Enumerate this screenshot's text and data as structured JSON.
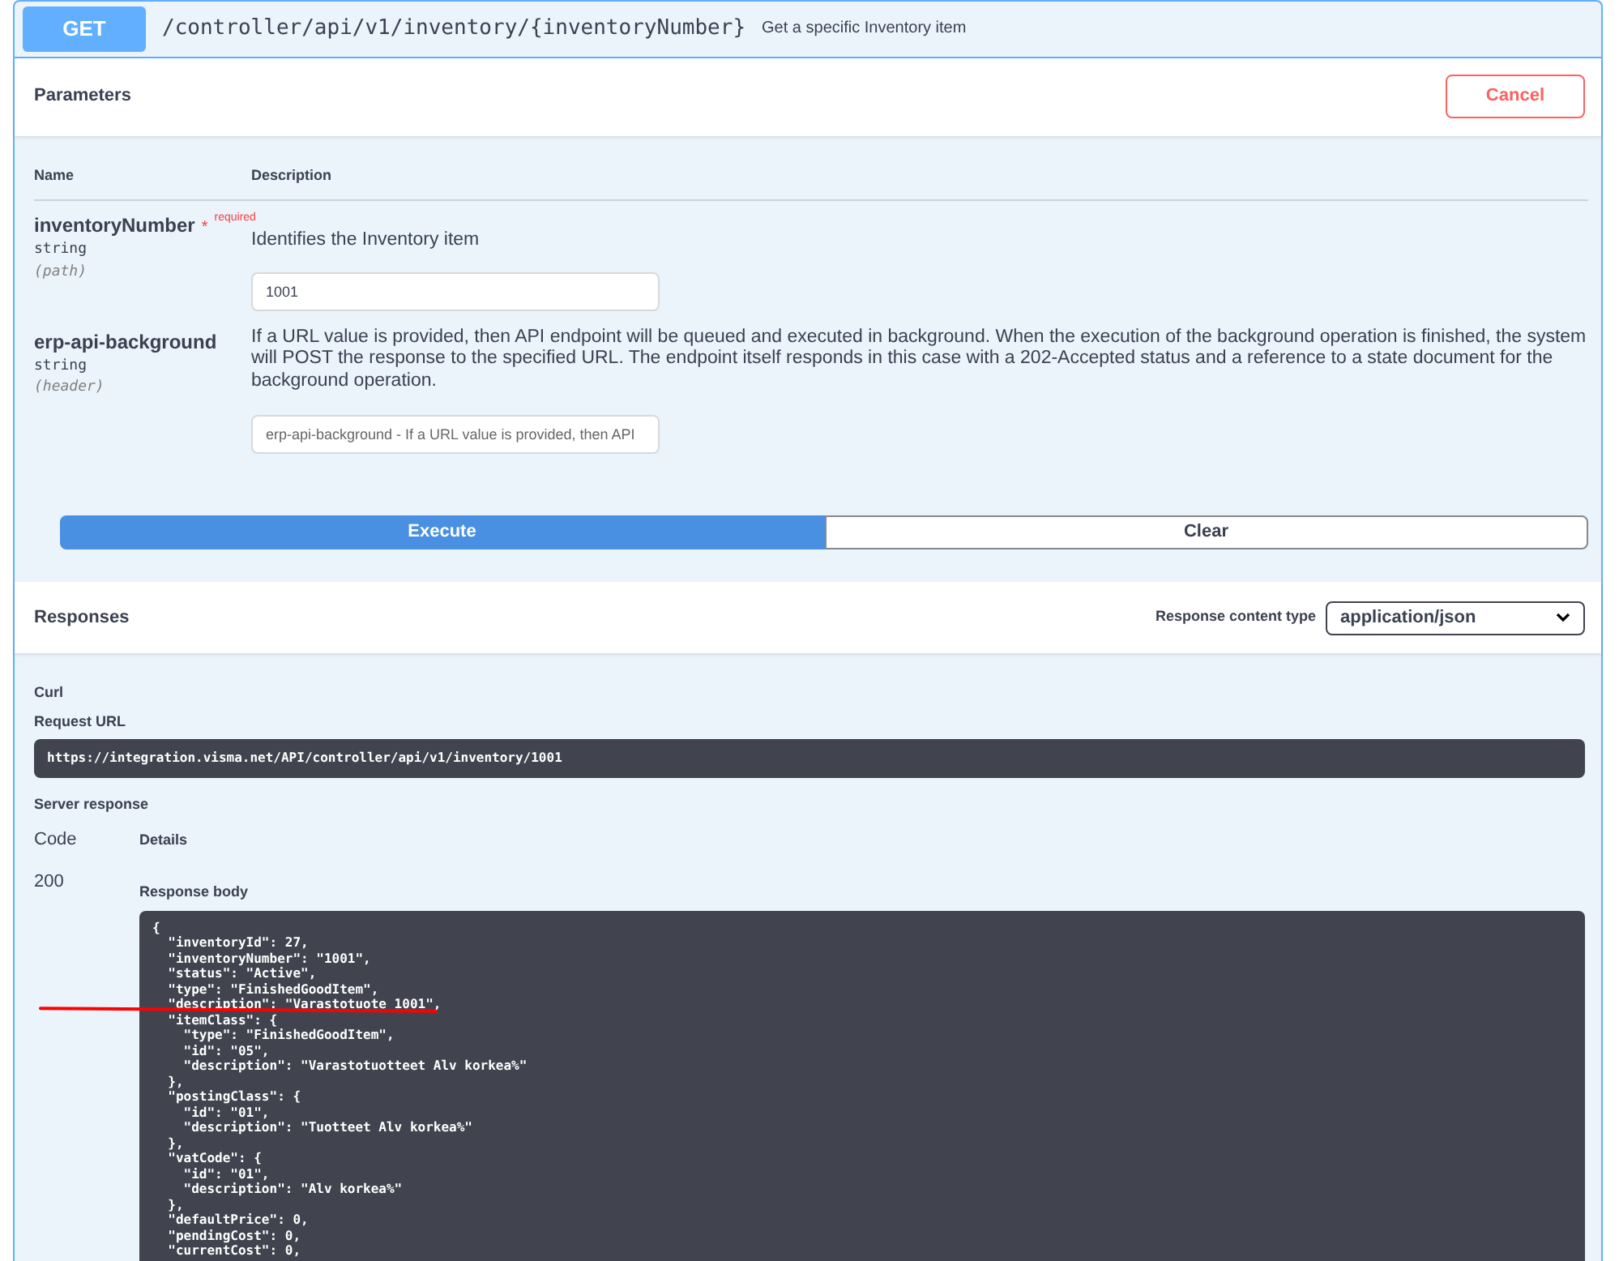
{
  "operation": {
    "method": "GET",
    "path": "/controller/api/v1/inventory/{inventoryNumber}",
    "summary": "Get a specific Inventory item"
  },
  "parameters": {
    "title": "Parameters",
    "cancel_button": "Cancel",
    "columns": [
      "Name",
      "Description"
    ],
    "rows": [
      {
        "name": "inventoryNumber",
        "required_mark": "*",
        "required_label": "required",
        "type": "string",
        "location": "(path)",
        "description": "Identifies the Inventory item",
        "value": "1001"
      },
      {
        "name": "erp-api-background",
        "type": "string",
        "location": "(header)",
        "description": "If a URL value is provided, then API endpoint will be queued and executed in background. When the execution of the background operation is finished, the system will POST the response to the specified URL. The endpoint itself responds in this case with a 202-Accepted status and a reference to a state document for the background operation.",
        "placeholder": "erp-api-background - If a URL value is provided, then API"
      }
    ],
    "execute_button": "Execute",
    "clear_button": "Clear"
  },
  "responses": {
    "title": "Responses",
    "content_type_label": "Response content type",
    "content_type": "application/json",
    "curl_label": "Curl",
    "request_url_label": "Request URL",
    "request_url": "https://integration.visma.net/API/controller/api/v1/inventory/1001",
    "server_response_label": "Server response",
    "columns": [
      "Code",
      "Details"
    ],
    "code": "200",
    "body_label": "Response body",
    "body_lines": [
      "{",
      "  \"inventoryId\": 27,",
      "  \"inventoryNumber\": \"1001\",",
      "  \"status\": \"Active\",",
      "  \"type\": \"FinishedGoodItem\",",
      "  \"description\": \"Varastotuote 1001\",",
      "  \"itemClass\": {",
      "    \"type\": \"FinishedGoodItem\",",
      "    \"id\": \"05\",",
      "    \"description\": \"Varastotuotteet Alv korkea%\"",
      "  },",
      "  \"postingClass\": {",
      "    \"id\": \"01\",",
      "    \"description\": \"Tuotteet Alv korkea%\"",
      "  },",
      "  \"vatCode\": {",
      "    \"id\": \"01\",",
      "    \"description\": \"Alv korkea%\"",
      "  },",
      "  \"defaultPrice\": 0,",
      "  \"pendingCost\": 0,",
      "  \"currentCost\": 0,"
    ]
  }
}
